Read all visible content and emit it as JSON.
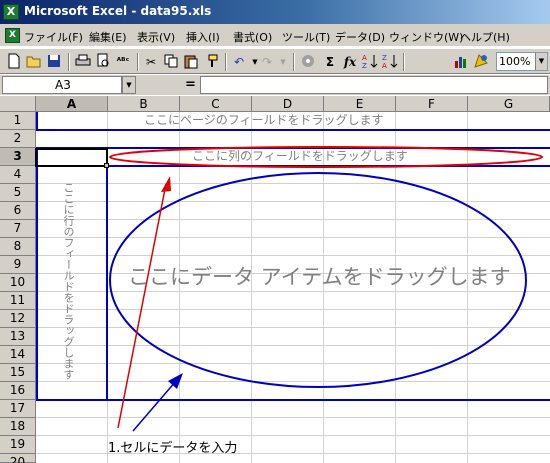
{
  "window": {
    "title": "Microsoft Excel - data95.xls",
    "app_icon": "excel-icon"
  },
  "menu": [
    {
      "label": "ファイル(F)"
    },
    {
      "label": "編集(E)"
    },
    {
      "label": "表示(V)"
    },
    {
      "label": "挿入(I)"
    },
    {
      "label": "書式(O)"
    },
    {
      "label": "ツール(T)"
    },
    {
      "label": "データ(D)"
    },
    {
      "label": "ウィンドウ(W)"
    },
    {
      "label": "ヘルプ(H)"
    }
  ],
  "toolbar": {
    "buttons": [
      "new-icon",
      "open-icon",
      "save-icon",
      "print-icon",
      "print-preview-icon",
      "spelling-icon",
      "cut-icon",
      "copy-icon",
      "paste-icon",
      "format-painter-icon",
      "undo-icon",
      "redo-icon",
      "hyperlink-icon",
      "autosum-icon",
      "function-icon",
      "sort-ascending-icon",
      "sort-descending-icon",
      "chart-wizard-icon",
      "drawing-icon"
    ],
    "sum_glyph": "Σ",
    "fx_glyph": "fx",
    "zoom": "100%"
  },
  "formula_bar": {
    "name_box": "A3",
    "equals": "=",
    "value": ""
  },
  "grid": {
    "columns": [
      "A",
      "B",
      "C",
      "D",
      "E",
      "F",
      "G"
    ],
    "rows": [
      "1",
      "2",
      "3",
      "4",
      "5",
      "6",
      "7",
      "8",
      "9",
      "10",
      "11",
      "12",
      "13",
      "14",
      "15",
      "16",
      "17",
      "18",
      "19",
      "20"
    ],
    "active_column": "A",
    "active_row": "3"
  },
  "pivot": {
    "page_field_text": "ここにページのフィールドをドラッグします",
    "column_field_text": "ここに列のフィールドをドラッグします",
    "row_field_text": "ここに行のフィールドをドラッグします",
    "data_item_text": "ここにデータ アイテムをドラッグします"
  },
  "annotation": {
    "text": "1.セルにデータを入力"
  },
  "colors": {
    "pivot_border": "#0000c0",
    "highlight_ellipse": "#e00000",
    "data_ellipse": "#0000c0",
    "arrow_red": "#e00000",
    "arrow_blue": "#0000c0"
  }
}
